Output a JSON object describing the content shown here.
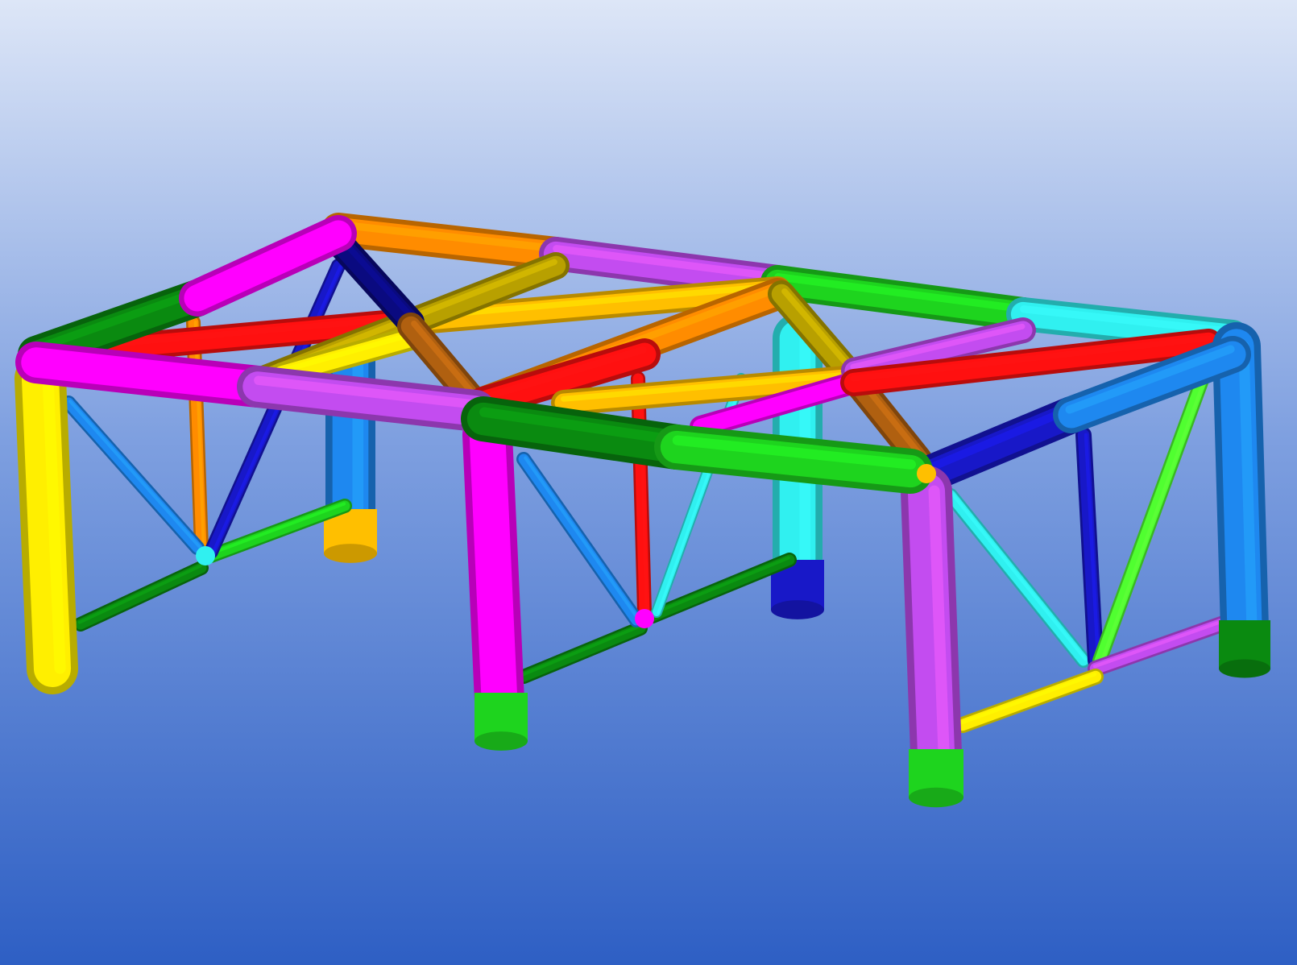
{
  "viewport": {
    "background_top": "#dde6f7",
    "background_bottom": "#2e5fc4"
  },
  "model": {
    "description_colors": {
      "yellow": "#ffef00",
      "magenta": "#ff00ff",
      "purple": "#c34cf0",
      "dark_green": "#0a8a10",
      "green": "#1ed41e",
      "orange": "#ff8c00",
      "gold": "#ffbf00",
      "red": "#ff1010",
      "navy": "#0a0a80",
      "blue": "#1818c8",
      "azure": "#1e88f0",
      "cyan": "#30f0f0",
      "brown": "#b06010",
      "olive": "#b8a000",
      "lime": "#50ff30"
    }
  }
}
